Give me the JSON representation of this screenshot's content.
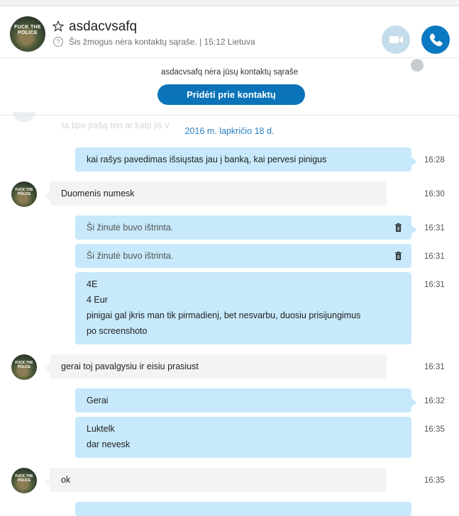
{
  "header": {
    "contact_name": "asdacvsafq",
    "status_text": "Šis žmogus nėra kontaktų sąraše.",
    "local_time": "| 15:12 Lietuva",
    "avatar_caption": "FUCK THE POLICE",
    "icons": [
      "star-icon",
      "info-icon",
      "video-camera-icon",
      "phone-icon",
      "globe-icon"
    ]
  },
  "banner": {
    "text": "asdacvsafq nėra jūsų kontaktų sąraše",
    "button_label": "Pridėti prie kontaktų"
  },
  "faded_text": "ta tipo įrašą ten ar kaip jis v",
  "date_separator": "2016 m. lapkričio 18 d.",
  "messages": [
    {
      "dir": "out",
      "lines": [
        "kai rašys pavedimas išsiųstas jau į banką, kai pervesi pinigus"
      ],
      "time": "16:28"
    },
    {
      "dir": "in",
      "lines": [
        "Duomenis numesk"
      ],
      "time": "16:30"
    },
    {
      "dir": "out",
      "lines": [
        "Ši žinutė buvo ištrinta."
      ],
      "time": "16:31",
      "deleted": true
    },
    {
      "dir": "out",
      "lines": [
        "Ši žinutė buvo ištrinta."
      ],
      "time": "16:31",
      "deleted": true
    },
    {
      "dir": "out",
      "lines": [
        "4E",
        "4 Eur",
        "pinigai gal įkris man tik pirmadienį, bet nesvarbu, duosiu prisijungimus",
        "po screenshoto"
      ],
      "time": "16:31"
    },
    {
      "dir": "in",
      "lines": [
        "gerai toj pavalgysiu ir eisiu prasiust"
      ],
      "time": "16:31"
    },
    {
      "dir": "out",
      "lines": [
        "Gerai"
      ],
      "time": "16:32"
    },
    {
      "dir": "out",
      "lines": [
        "Luktelk",
        "dar nevesk"
      ],
      "time": "16:35"
    },
    {
      "dir": "in",
      "lines": [
        "ok"
      ],
      "time": "16:35"
    }
  ],
  "colors": {
    "accent": "#0b73b8",
    "outgoing_bubble": "#c7e9fb",
    "incoming_bubble": "#f2f3f5",
    "date_separator": "#2d82c5"
  }
}
